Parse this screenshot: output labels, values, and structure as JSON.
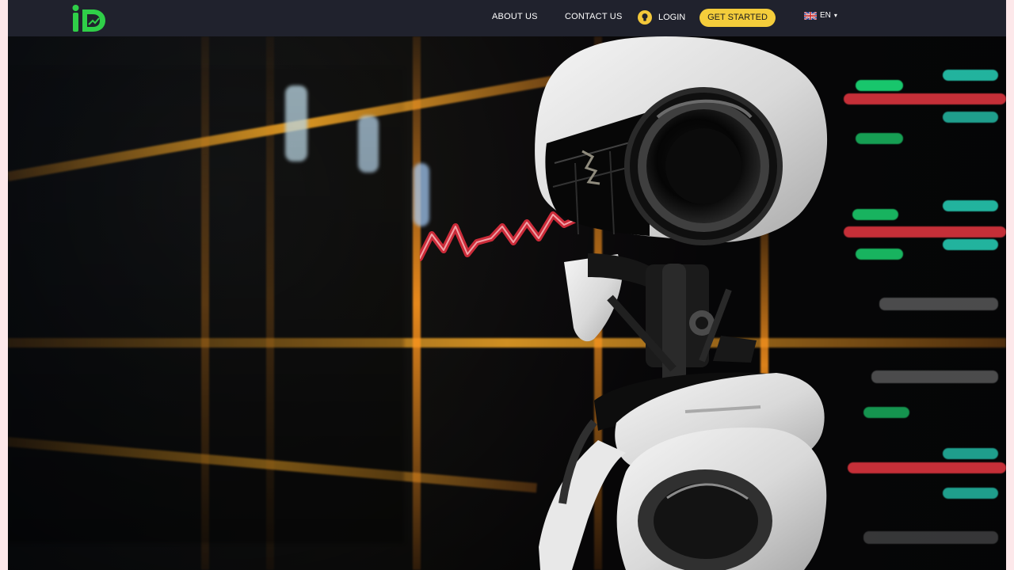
{
  "header": {
    "logo_text": "iD",
    "nav": {
      "about": "ABOUT US",
      "contact": "CONTACT US",
      "login": "LOGIN",
      "get_started": "GET STARTED",
      "language": "EN"
    }
  },
  "colors": {
    "accent_yellow": "#f4cd3b",
    "header_bg": "#20222d",
    "logo_green": "#2fcf48"
  },
  "icons": {
    "logo": "logo-icon",
    "login": "lightbulb-icon",
    "flag": "uk-flag-icon",
    "dropdown": "chevron-down-icon"
  }
}
